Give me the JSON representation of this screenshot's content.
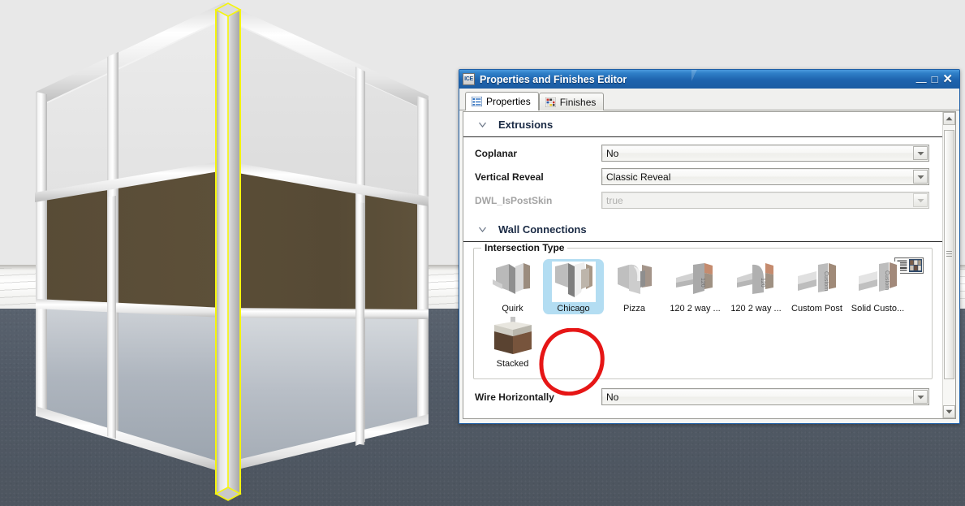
{
  "viewport": {
    "name": "3d-model-viewport",
    "description": "3D rendering of an office cubicle wall corner with glass top panels, brown fabric mid panels, glazed lower panels and a highlighted yellow corner post",
    "scene_colors": {
      "background_wall": "#e8e8e8",
      "floor": "#525b66",
      "fabric_panel": "#574a35",
      "frame_metal": "#e4e4e4",
      "selection_highlight": "#f2f20a"
    }
  },
  "window": {
    "title": "Properties and Finishes Editor",
    "app_icon": "ICE",
    "controls": {
      "minimize": "—",
      "maximize": "□",
      "close": "✕"
    }
  },
  "tabs": [
    {
      "label": "Properties",
      "icon": "list-icon",
      "active": true
    },
    {
      "label": "Finishes",
      "icon": "color-grid-icon",
      "active": false
    }
  ],
  "sections": [
    {
      "title": "Extrusions",
      "expanded": true,
      "chevron": "chevron-down-icon",
      "rows": [
        {
          "label": "Coplanar",
          "value": "No",
          "disabled": false
        },
        {
          "label": "Vertical Reveal",
          "value": "Classic Reveal",
          "disabled": false
        },
        {
          "label": "DWL_IsPostSkin",
          "value": "true",
          "disabled": true
        }
      ]
    },
    {
      "title": "Wall Connections",
      "expanded": true,
      "chevron": "chevron-down-icon",
      "group": {
        "legend": "Intersection Type",
        "view_toggle": "list-grid-view-toggle-icon",
        "items": [
          {
            "label": "Quirk",
            "selected": false
          },
          {
            "label": "Chicago",
            "selected": true
          },
          {
            "label": "Pizza",
            "selected": false
          },
          {
            "label": "120 2 way ...",
            "selected": false
          },
          {
            "label": "120 2 way ...",
            "selected": false
          },
          {
            "label": "Custom Post",
            "selected": false
          },
          {
            "label": "Solid Custo...",
            "selected": false
          },
          {
            "label": "Stacked",
            "selected": false,
            "annotated": true
          }
        ]
      },
      "rows": [
        {
          "label": "Wire Horizontally",
          "value": "No",
          "disabled": false
        }
      ]
    }
  ],
  "scrollbar": {
    "up_arrow": "▲",
    "down_arrow": "▼",
    "name": "vertical-scrollbar"
  },
  "annotation": {
    "shape": "hand-drawn-red-ellipse",
    "color": "#e61616",
    "targets": "Stacked"
  }
}
